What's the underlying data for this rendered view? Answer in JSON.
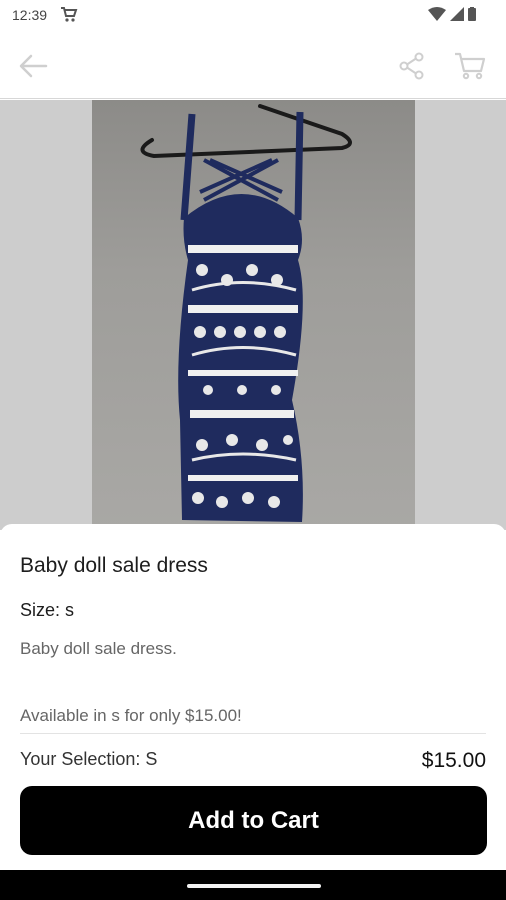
{
  "status_bar": {
    "time": "12:39",
    "icons": [
      "cart-notification-icon",
      "wifi-icon",
      "signal-icon",
      "battery-icon"
    ]
  },
  "topbar": {
    "icons": [
      "back-arrow-icon",
      "share-icon",
      "cart-icon"
    ]
  },
  "product": {
    "title": "Baby doll sale dress",
    "size_label": "Size: s",
    "description": "Baby doll sale dress.",
    "availability": "Available in s for only $15.00!"
  },
  "purchase": {
    "selection": "Your Selection: S",
    "price": "$15.00",
    "add_to_cart_label": "Add to Cart"
  },
  "colors": {
    "accent": "#000000",
    "dress": "#1f2b5e",
    "pattern": "#f2f2f2"
  }
}
